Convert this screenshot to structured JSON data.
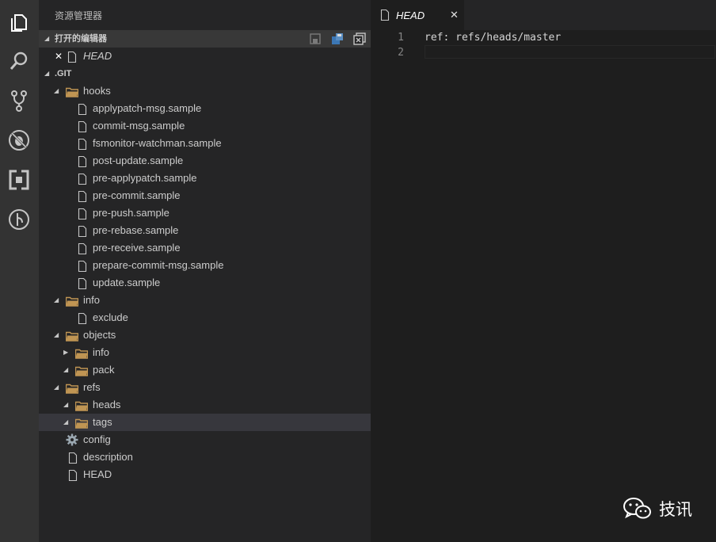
{
  "activity_bar": {
    "icons": [
      "explorer-icon",
      "search-icon",
      "source-control-icon",
      "debug-icon",
      "extensions-icon",
      "gitlens-icon"
    ]
  },
  "sidebar": {
    "title": "资源管理器",
    "open_editors": {
      "header": "打开的编辑器",
      "items": [
        {
          "label": "HEAD"
        }
      ]
    },
    "folder": {
      "header": ".GIT",
      "tree": [
        {
          "label": "hooks",
          "type": "folder",
          "expanded": true
        },
        {
          "label": "applypatch-msg.sample",
          "type": "file"
        },
        {
          "label": "commit-msg.sample",
          "type": "file"
        },
        {
          "label": "fsmonitor-watchman.sample",
          "type": "file"
        },
        {
          "label": "post-update.sample",
          "type": "file"
        },
        {
          "label": "pre-applypatch.sample",
          "type": "file"
        },
        {
          "label": "pre-commit.sample",
          "type": "file"
        },
        {
          "label": "pre-push.sample",
          "type": "file"
        },
        {
          "label": "pre-rebase.sample",
          "type": "file"
        },
        {
          "label": "pre-receive.sample",
          "type": "file"
        },
        {
          "label": "prepare-commit-msg.sample",
          "type": "file"
        },
        {
          "label": "update.sample",
          "type": "file"
        },
        {
          "label": "info",
          "type": "folder",
          "expanded": true
        },
        {
          "label": "exclude",
          "type": "file"
        },
        {
          "label": "objects",
          "type": "folder",
          "expanded": true
        },
        {
          "label": "info",
          "type": "folder",
          "expanded": false
        },
        {
          "label": "pack",
          "type": "folder",
          "expanded": true
        },
        {
          "label": "refs",
          "type": "folder",
          "expanded": true
        },
        {
          "label": "heads",
          "type": "folder",
          "expanded": true
        },
        {
          "label": "tags",
          "type": "folder",
          "expanded": true,
          "selected": true
        },
        {
          "label": "config",
          "type": "config"
        },
        {
          "label": "description",
          "type": "file"
        },
        {
          "label": "HEAD",
          "type": "file"
        }
      ]
    }
  },
  "editor": {
    "tab": {
      "label": "HEAD",
      "close": "✕"
    },
    "lines": [
      {
        "num": "1",
        "text": "ref: refs/heads/master"
      },
      {
        "num": "2",
        "text": ""
      }
    ]
  },
  "watermark": {
    "label": "技讯"
  },
  "colors": {
    "activity_bar": "#333333",
    "sidebar": "#252526",
    "editor": "#1e1e1e",
    "folder": "#c09553",
    "selected_row": "#37373d"
  }
}
